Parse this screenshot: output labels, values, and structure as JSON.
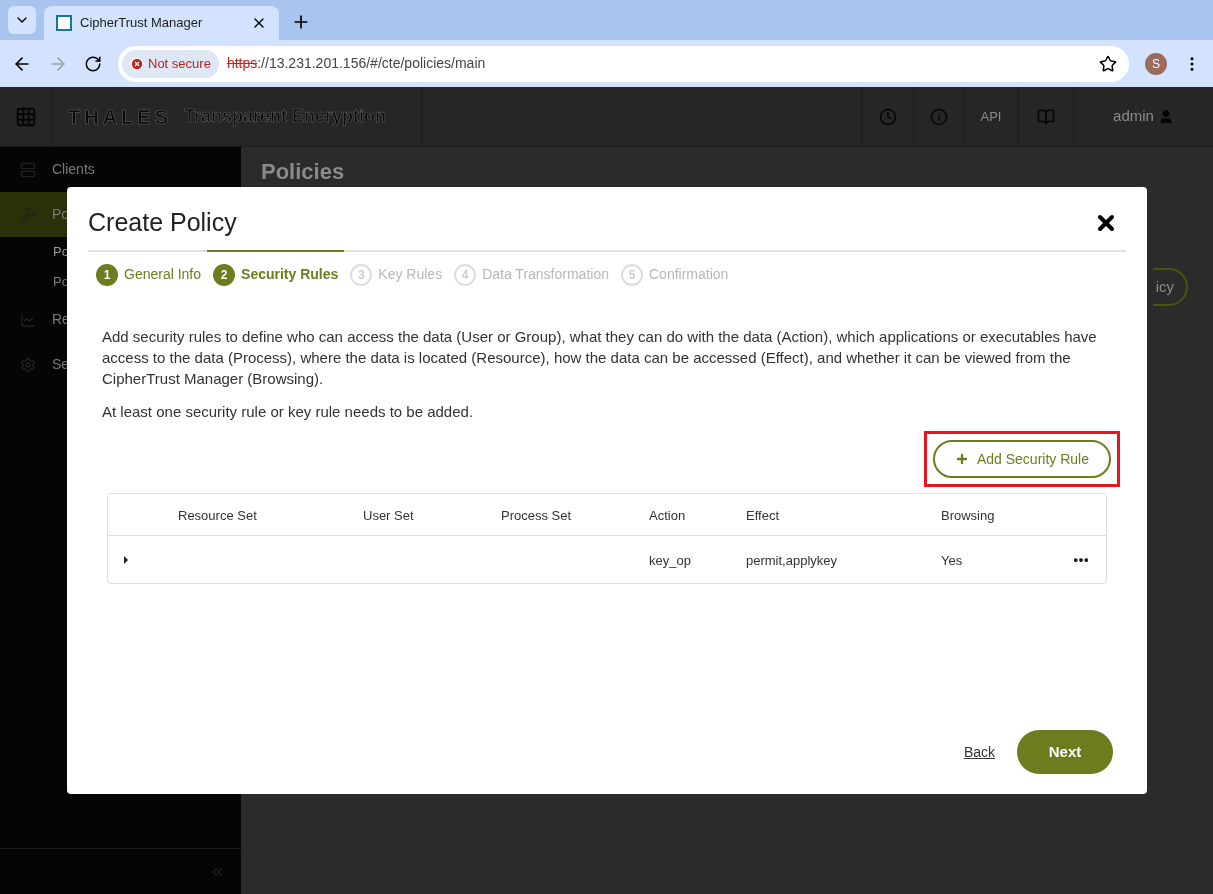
{
  "browser": {
    "tab_title": "CipherTrust Manager",
    "security_label": "Not secure",
    "url_scheme": "https",
    "url_rest": "://13.231.201.156/#/cte/policies/main",
    "profile_initial": "S"
  },
  "app_header": {
    "brand": "THALES",
    "product": "Transparent Encryption",
    "api_label": "API",
    "user": "admin"
  },
  "sidebar": {
    "items": [
      {
        "label": "Clients",
        "kind": "group",
        "selected": false
      },
      {
        "label": "Po",
        "kind": "group",
        "selected": true
      },
      {
        "label": "Po",
        "kind": "sub",
        "selected": true
      },
      {
        "label": "Po",
        "kind": "sub",
        "selected": false
      },
      {
        "label": "Re",
        "kind": "group",
        "selected": false
      },
      {
        "label": "Se",
        "kind": "group",
        "selected": false
      }
    ]
  },
  "page": {
    "title": "Policies",
    "action_button": "icy"
  },
  "dialog": {
    "title": "Create Policy",
    "steps": [
      {
        "number": "1",
        "label": "General Info",
        "selected": false,
        "disabled": false
      },
      {
        "number": "2",
        "label": "Security Rules",
        "selected": true,
        "disabled": false
      },
      {
        "number": "3",
        "label": "Key Rules",
        "selected": false,
        "disabled": true
      },
      {
        "number": "4",
        "label": "Data Transformation",
        "selected": false,
        "disabled": true
      },
      {
        "number": "5",
        "label": "Confirmation",
        "selected": false,
        "disabled": true
      }
    ],
    "description": "Add security rules to define who can access the data (User or Group), what they can do with the data (Action), which applications or executables have access to the data (Process), where the data is located (Resource), how the data can be accessed (Effect), and whether it can be viewed from the CipherTrust Manager (Browsing).",
    "note": "At least one security rule or key rule needs to be added.",
    "add_button": "Add Security Rule",
    "table": {
      "columns": [
        "Resource Set",
        "User Set",
        "Process Set",
        "Action",
        "Effect",
        "Browsing"
      ],
      "rows": [
        {
          "expanded": false,
          "cells": [
            "",
            "",
            "",
            "key_op",
            "permit,applykey",
            "Yes"
          ]
        }
      ]
    },
    "back_link": "Back",
    "next_button": "Next"
  }
}
